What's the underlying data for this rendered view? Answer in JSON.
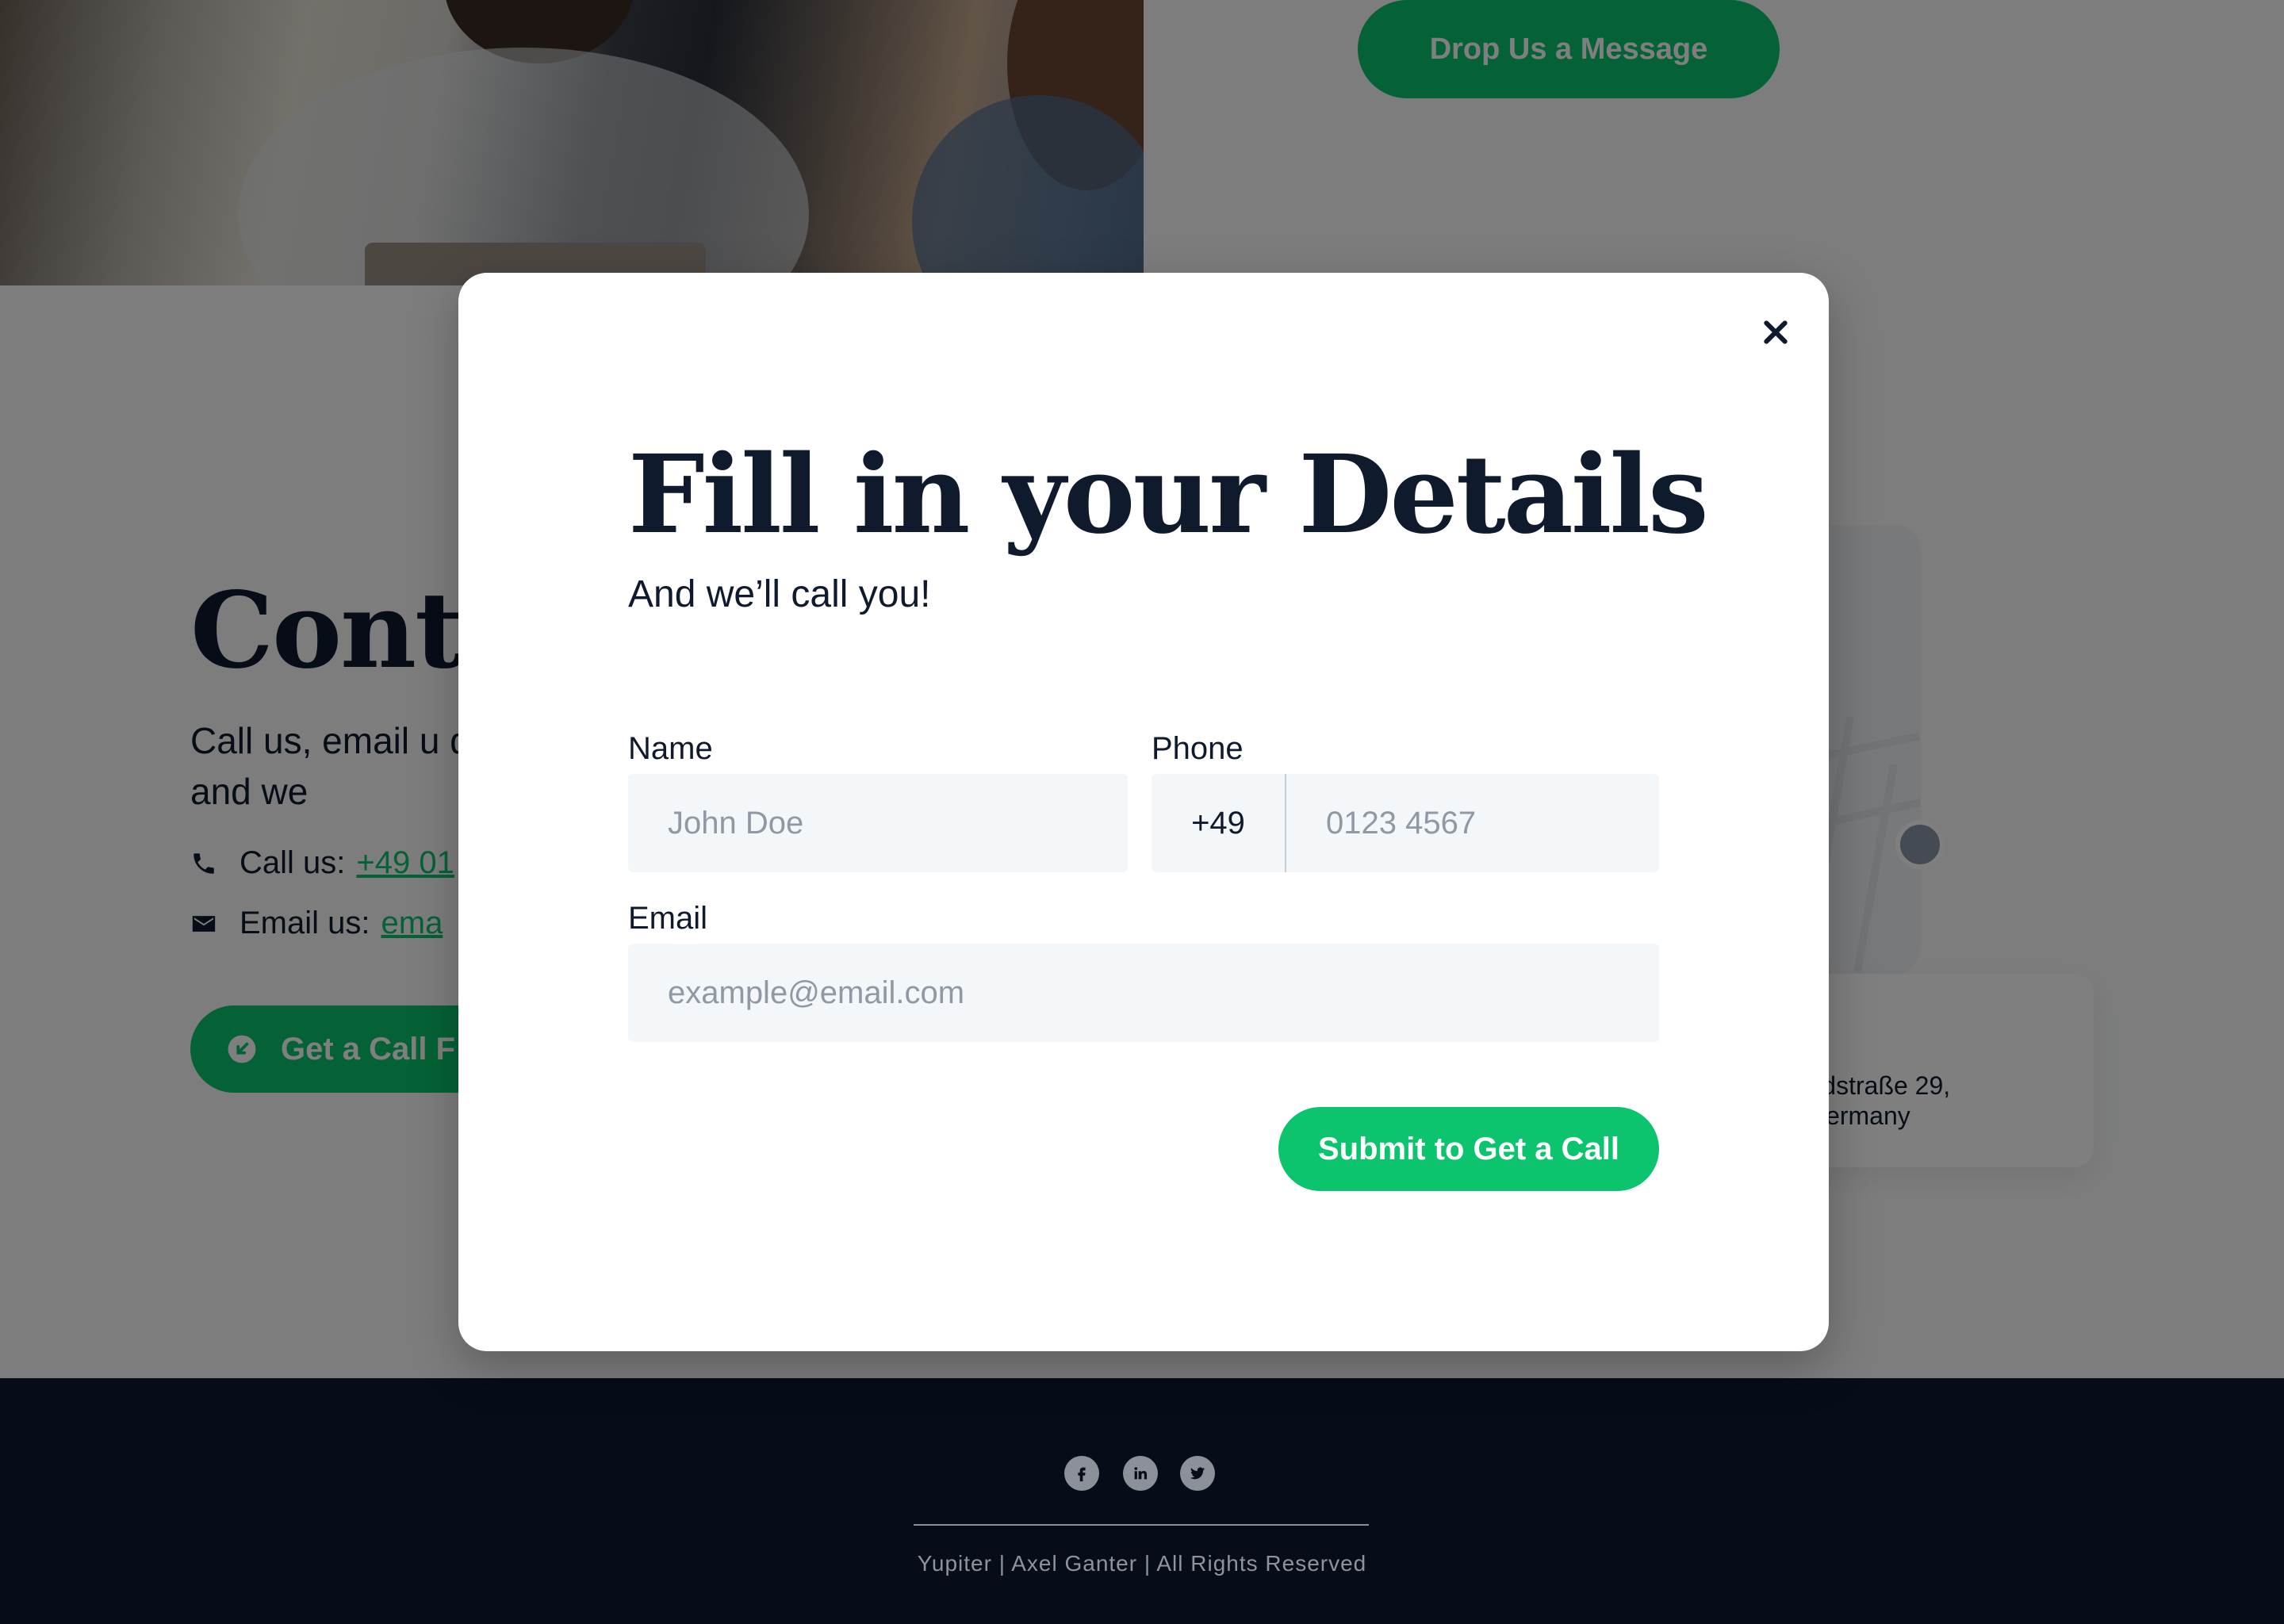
{
  "hero": {
    "drop_message_label": "Drop Us a Message"
  },
  "contact": {
    "title": "Conta",
    "subtitle": "Call us, email u details and we",
    "call_label": "Call us:",
    "call_value": "+49 01",
    "email_label": "Email us:",
    "email_value": "ema",
    "call_button_label": "Get a Call F",
    "address": "ne, Waldstraße 29,\nbach, Germany"
  },
  "modal": {
    "title": "Fill in your Details",
    "subtitle": "And we’ll call you!",
    "name_label": "Name",
    "name_placeholder": "John Doe",
    "phone_label": "Phone",
    "phone_prefix": "+49",
    "phone_placeholder": "0123 4567",
    "email_label": "Email",
    "email_placeholder": "example@email.com",
    "submit_label": "Submit to Get a Call"
  },
  "footer": {
    "text": "Yupiter | Axel Ganter | All Rights Reserved",
    "social": [
      "facebook-icon",
      "linkedin-icon",
      "twitter-icon"
    ]
  },
  "colors": {
    "accent": "#0bc46d",
    "navy": "#0f1b2d",
    "footer_bg": "#060c18",
    "input_bg": "#f4f7fa"
  }
}
